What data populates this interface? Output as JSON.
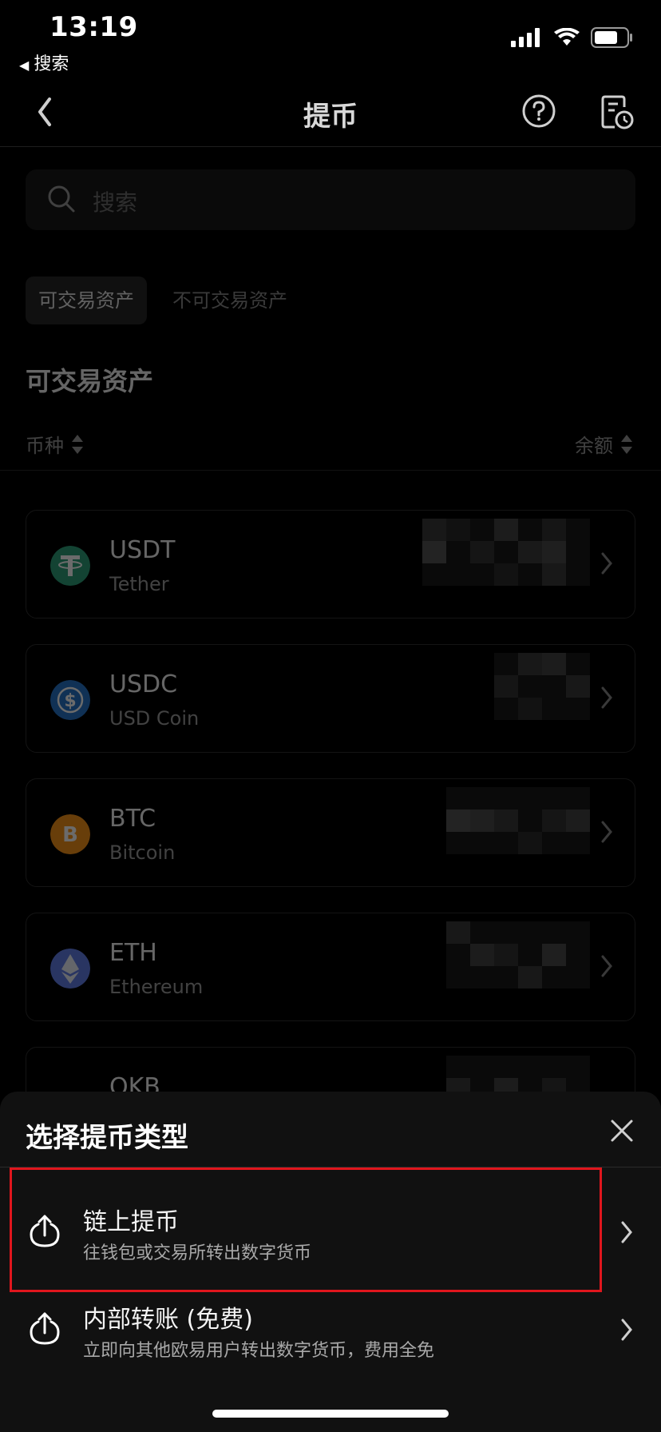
{
  "status_bar": {
    "time": "13:19",
    "back_app": "搜索"
  },
  "navbar": {
    "title": "提币"
  },
  "search": {
    "placeholder": "搜索"
  },
  "tabs": [
    {
      "label": "可交易资产",
      "active": true
    },
    {
      "label": "不可交易资产",
      "active": false
    }
  ],
  "section_title": "可交易资产",
  "columns": {
    "coin": "币种",
    "balance": "余额"
  },
  "coins": [
    {
      "symbol": "USDT",
      "name": "Tether",
      "color": "#2ea07b"
    },
    {
      "symbol": "USDC",
      "name": "USD Coin",
      "color": "#2775ca"
    },
    {
      "symbol": "BTC",
      "name": "Bitcoin",
      "color": "#f7931a"
    },
    {
      "symbol": "ETH",
      "name": "Ethereum",
      "color": "#627eea"
    },
    {
      "symbol": "OKB",
      "name": "",
      "color": "#ffffff"
    }
  ],
  "sheet": {
    "title": "选择提币类型",
    "options": [
      {
        "title": "链上提币",
        "desc": "往钱包或交易所转出数字货币"
      },
      {
        "title": "内部转账 (免费)",
        "desc": "立即向其他欧易用户转出数字货币，费用全免"
      }
    ]
  },
  "colors": {
    "highlight": "#e0161d",
    "background": "#000000",
    "sheet": "#111111"
  }
}
